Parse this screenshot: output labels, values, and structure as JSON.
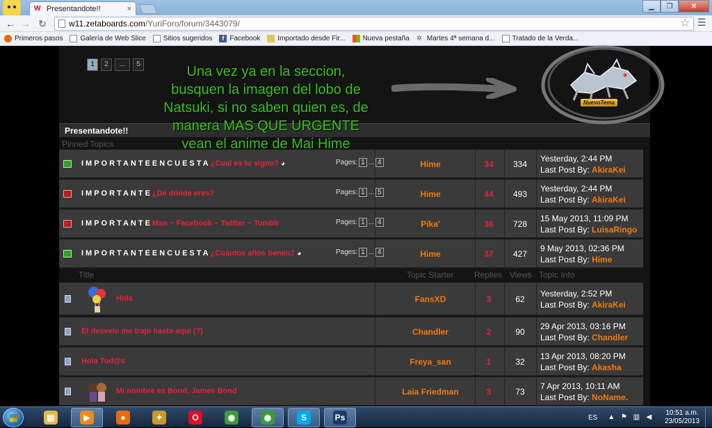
{
  "browser": {
    "tab_title": "Presentandote!!",
    "tab_close": "×",
    "url_host": "w11.zetaboards.com",
    "url_path": "/YuriForo/forum/3443079/",
    "bookmarks": [
      {
        "label": "Primeros pasos",
        "icon": "firefox-icon"
      },
      {
        "label": "Galería de Web Slice",
        "icon": "page-icon"
      },
      {
        "label": "Sitios sugeridos",
        "icon": "page-icon"
      },
      {
        "label": "Facebook",
        "icon": "facebook-icon"
      },
      {
        "label": "Importado desde Fir...",
        "icon": "folder-icon"
      },
      {
        "label": "Nueva pestaña",
        "icon": "windows-icon"
      },
      {
        "label": "Martes 4ª semana d...",
        "icon": "site-icon"
      },
      {
        "label": "Tratado de la Verda...",
        "icon": "page-icon"
      }
    ]
  },
  "pager_top": [
    "1",
    "2",
    "...",
    "5"
  ],
  "overlay_text": "Una vez ya en la seccion, busquen la imagen del lobo de Natsuki, si no saben quien es, de manera MAS QUE URGENTE vean el anime de Mai Hime",
  "new_topic_label": "NuevoTema",
  "forum": {
    "header": "Presentandote!!",
    "pinned_label": "Pinned Topics",
    "columns": {
      "title": "Title",
      "starter": "Topic Starter",
      "replies": "Replies",
      "views": "Views",
      "info": "Topic Info"
    },
    "pinned": [
      {
        "prefix": "IMPORTANTEENCUESTA",
        "title": "¿Cual es tu signo?",
        "poll": true,
        "pages_label": "Pages:",
        "pages": [
          "1",
          "...",
          "4"
        ],
        "starter": "Hime",
        "replies": "34",
        "views": "334",
        "date": "Yesterday, 2:44 PM",
        "lp_label": "Last Post By:",
        "lp_user": "AkiraKei",
        "icon": "green"
      },
      {
        "prefix": "IMPORTANTE",
        "title": "¿De dónde eres?",
        "poll": false,
        "pages_label": "Pages:",
        "pages": [
          "1",
          "...",
          "5"
        ],
        "starter": "Hime",
        "replies": "44",
        "views": "493",
        "date": "Yesterday, 2:44 PM",
        "lp_label": "Last Post By:",
        "lp_user": "AkiraKei",
        "icon": "red"
      },
      {
        "prefix": "IMPORTANTE",
        "title": "Msn ~ Facebook ~ Twitter ~ Tumblr",
        "poll": false,
        "pages_label": "Pages:",
        "pages": [
          "1",
          "...",
          "4"
        ],
        "starter": "Pika'",
        "replies": "36",
        "views": "728",
        "date": "15 May 2013, 11:09 PM",
        "lp_label": "Last Post By:",
        "lp_user": "LuisaRingo",
        "icon": "red"
      },
      {
        "prefix": "IMPORTANTEENCUESTA",
        "title": "¿Cuántos años tienen?",
        "poll": true,
        "pages_label": "Pages:",
        "pages": [
          "1",
          "...",
          "4"
        ],
        "starter": "Hime",
        "replies": "37",
        "views": "427",
        "date": "9 May 2013, 02:36 PM",
        "lp_label": "Last Post By:",
        "lp_user": "Hime",
        "icon": "green"
      }
    ],
    "topics": [
      {
        "title": "Hola",
        "starter": "FansXD",
        "replies": "3",
        "views": "62",
        "date": "Yesterday, 2:52 PM",
        "lp_label": "Last Post By:",
        "lp_user": "AkiraKei",
        "avatar": "balloons"
      },
      {
        "title": "El desvelo me trajo hasta aqui (?)",
        "starter": "Chandler",
        "replies": "2",
        "views": "90",
        "date": "29 Apr 2013, 03:16 PM",
        "lp_label": "Last Post By:",
        "lp_user": "Chandler",
        "avatar": ""
      },
      {
        "title": "Hola Tod@s",
        "starter": "Freya_san",
        "replies": "1",
        "views": "32",
        "date": "13 Apr 2013, 08:20 PM",
        "lp_label": "Last Post By:",
        "lp_user": "Akasha",
        "avatar": ""
      },
      {
        "title": "Mi nombre es Bond, James Bond",
        "starter": "Laia Friedman",
        "replies": "3",
        "views": "73",
        "date": "7 Apr 2013, 10:11 AM",
        "lp_label": "Last Post By:",
        "lp_user": "NoName.",
        "avatar": "chibis"
      }
    ]
  },
  "taskbar": {
    "lang": "ES",
    "time": "10:51 a.m.",
    "date": "23/05/2013",
    "apps": [
      {
        "name": "explorer",
        "glyph": "▤",
        "color": "#e6b84a",
        "open": false
      },
      {
        "name": "media-player",
        "glyph": "▶",
        "color": "#f08a1a",
        "open": true
      },
      {
        "name": "firefox",
        "glyph": "●",
        "color": "#e86a10",
        "open": false
      },
      {
        "name": "game",
        "glyph": "✦",
        "color": "#c99a2a",
        "open": false
      },
      {
        "name": "opera",
        "glyph": "O",
        "color": "#d8102a",
        "open": false
      },
      {
        "name": "chrome",
        "glyph": "◉",
        "color": "#3c9a3c",
        "open": false
      },
      {
        "name": "chrome-active",
        "glyph": "◉",
        "color": "#3c9a3c",
        "open": true
      },
      {
        "name": "skype",
        "glyph": "S",
        "color": "#00a9ef",
        "open": true
      },
      {
        "name": "photoshop",
        "glyph": "Ps",
        "color": "#1c3a6a",
        "open": true
      }
    ]
  }
}
